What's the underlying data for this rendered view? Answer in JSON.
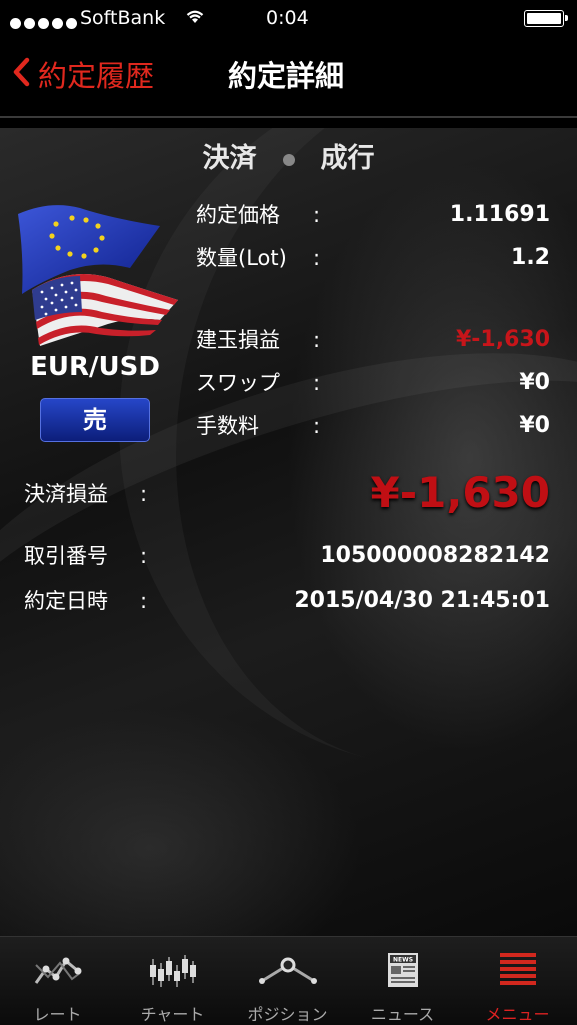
{
  "status_bar": {
    "carrier": "SoftBank",
    "time": "0:04"
  },
  "nav": {
    "back_label": "約定履歴",
    "title": "約定詳細"
  },
  "header": {
    "type": "決済",
    "order": "成行"
  },
  "instrument": {
    "pair": "EUR/USD",
    "side": "売"
  },
  "details": [
    {
      "label": "約定価格",
      "value": "1.11691",
      "color": "#ffffff"
    },
    {
      "label": "数量(Lot)",
      "value": "1.2",
      "color": "#ffffff"
    },
    {
      "label": "建玉損益",
      "value": "¥-1,630",
      "color": "#c7151a"
    },
    {
      "label": "スワップ",
      "value": "¥0",
      "color": "#ffffff"
    },
    {
      "label": "手数料",
      "value": "¥0",
      "color": "#ffffff"
    }
  ],
  "settlement": {
    "label": "決済損益",
    "value": "¥-1,630"
  },
  "info": [
    {
      "label": "取引番号",
      "value": "105000008282142"
    },
    {
      "label": "約定日時",
      "value": "2015/04/30 21:45:01"
    }
  ],
  "colon": ":",
  "tabs": [
    {
      "label": "レート",
      "icon": "rate-icon"
    },
    {
      "label": "チャート",
      "icon": "chart-icon"
    },
    {
      "label": "ポジション",
      "icon": "position-icon"
    },
    {
      "label": "ニュース",
      "icon": "news-icon",
      "badge": "NEWS"
    },
    {
      "label": "メニュー",
      "icon": "menu-icon",
      "active": true
    }
  ],
  "colors": {
    "accent": "#e0281e",
    "loss": "#c7151a",
    "sell_button": "#1a34a8"
  }
}
